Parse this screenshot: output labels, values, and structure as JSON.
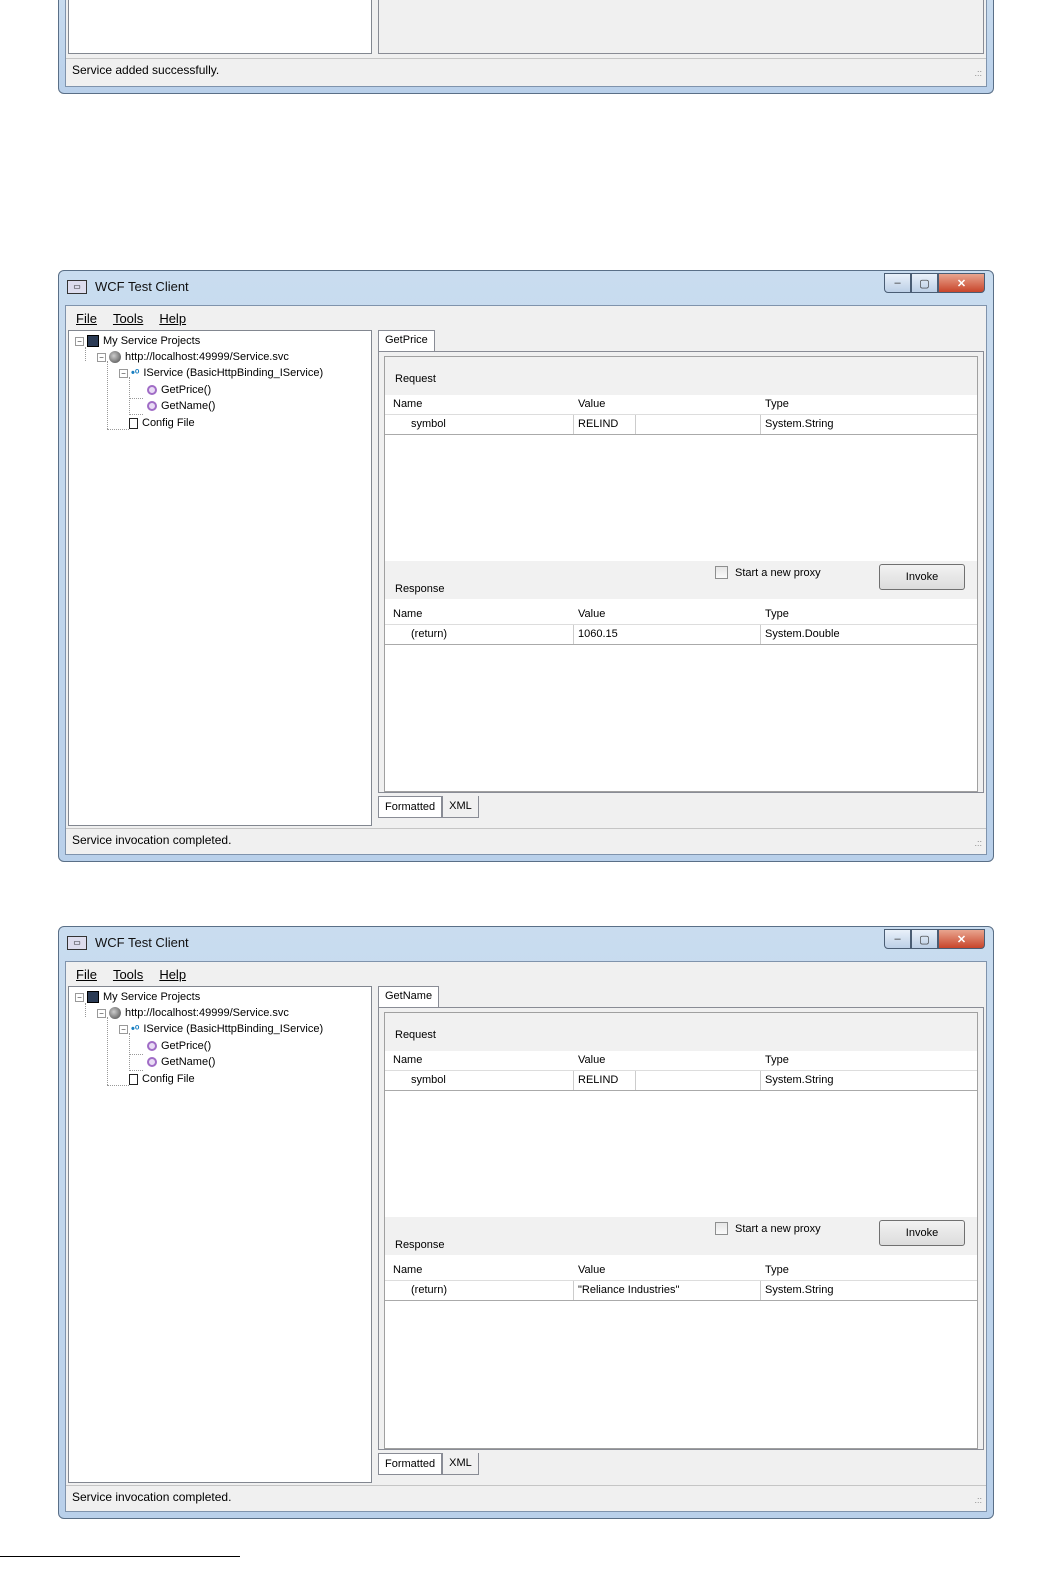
{
  "top_window": {
    "status": "Service added successfully."
  },
  "windows": [
    {
      "title": "WCF Test Client",
      "menu": [
        "File",
        "Tools",
        "Help"
      ],
      "tree": {
        "root": "My Service Projects",
        "endpoint": "http://localhost:49999/Service.svc",
        "contract": "IService (BasicHttpBinding_IService)",
        "methods": [
          "GetPrice()",
          "GetName()"
        ],
        "config": "Config File"
      },
      "tab_title": "GetPrice",
      "request_label": "Request",
      "response_label": "Response",
      "columns": [
        "Name",
        "Value",
        "Type"
      ],
      "request_row": {
        "name": "symbol",
        "value": "RELIND",
        "type": "System.String"
      },
      "response_row": {
        "name": "(return)",
        "value": "1060.15",
        "type": "System.Double"
      },
      "proxy_label": "Start a new proxy",
      "invoke_label": "Invoke",
      "bottom_tabs": [
        "Formatted",
        "XML"
      ],
      "status": "Service invocation completed."
    },
    {
      "title": "WCF Test Client",
      "menu": [
        "File",
        "Tools",
        "Help"
      ],
      "tree": {
        "root": "My Service Projects",
        "endpoint": "http://localhost:49999/Service.svc",
        "contract": "IService (BasicHttpBinding_IService)",
        "methods": [
          "GetPrice()",
          "GetName()"
        ],
        "config": "Config File"
      },
      "tab_title": "GetName",
      "request_label": "Request",
      "response_label": "Response",
      "columns": [
        "Name",
        "Value",
        "Type"
      ],
      "request_row": {
        "name": "symbol",
        "value": "RELIND",
        "type": "System.String"
      },
      "response_row": {
        "name": "(return)",
        "value": "\"Reliance Industries\"",
        "type": "System.String"
      },
      "proxy_label": "Start a new proxy",
      "invoke_label": "Invoke",
      "bottom_tabs": [
        "Formatted",
        "XML"
      ],
      "status": "Service invocation completed."
    }
  ]
}
